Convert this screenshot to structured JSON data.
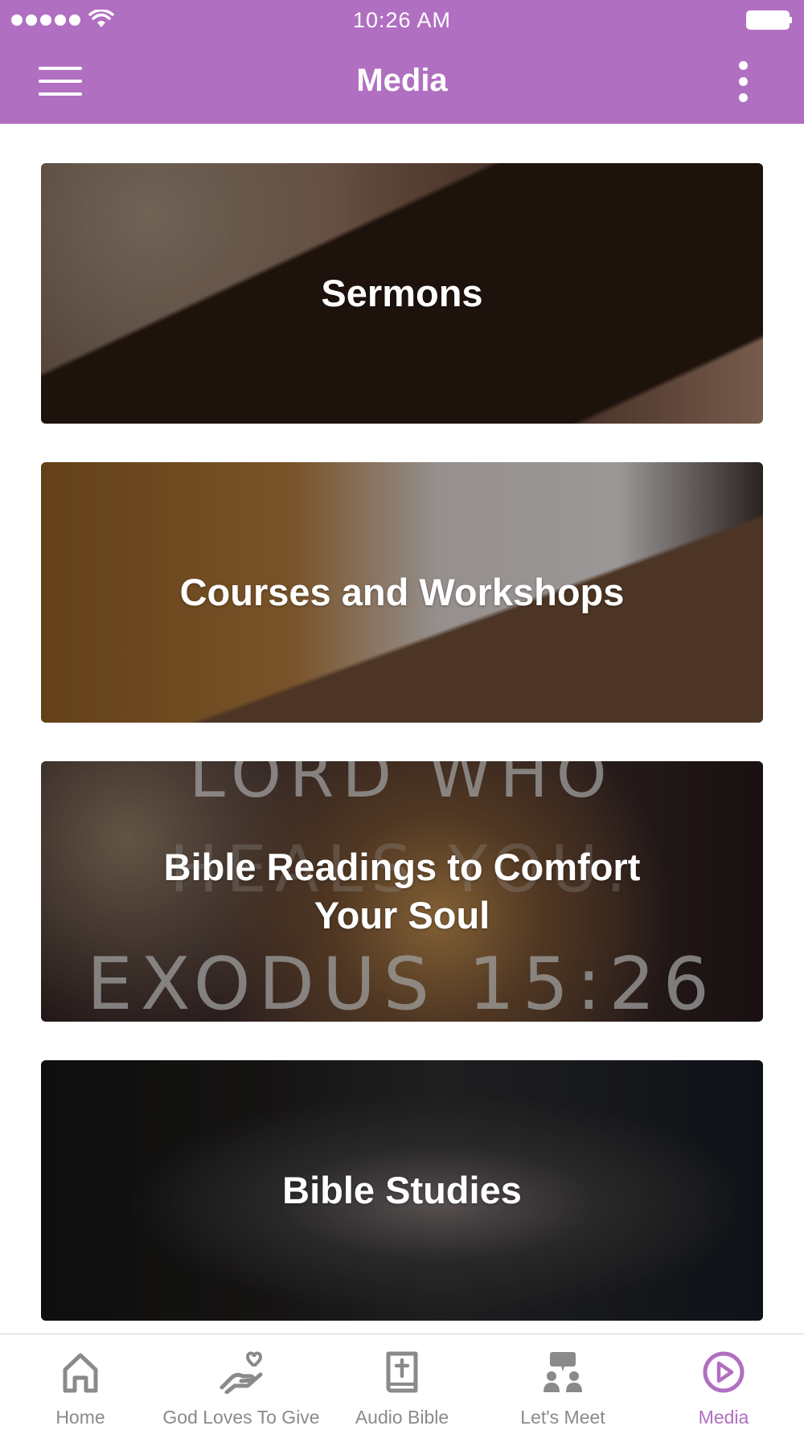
{
  "status_bar": {
    "time": "10:26 AM"
  },
  "header": {
    "title": "Media"
  },
  "cards": [
    {
      "label": "Sermons"
    },
    {
      "label": "Courses and Workshops"
    },
    {
      "label": "Bible Readings to Comfort Your Soul",
      "background_text": [
        "LORD WHO",
        "HEALS YOU.",
        "EXODUS 15:26"
      ]
    },
    {
      "label": "Bible Studies"
    }
  ],
  "tabs": [
    {
      "label": "Home",
      "icon": "home-icon"
    },
    {
      "label": "God Loves To Give",
      "icon": "heart-hand-icon"
    },
    {
      "label": "Audio Bible",
      "icon": "bible-icon"
    },
    {
      "label": "Let's Meet",
      "icon": "people-meeting-icon"
    },
    {
      "label": "Media",
      "icon": "play-circle-icon",
      "active": true
    }
  ],
  "colors": {
    "accent": "#b06fc1",
    "inactive": "#8a8a8a"
  }
}
